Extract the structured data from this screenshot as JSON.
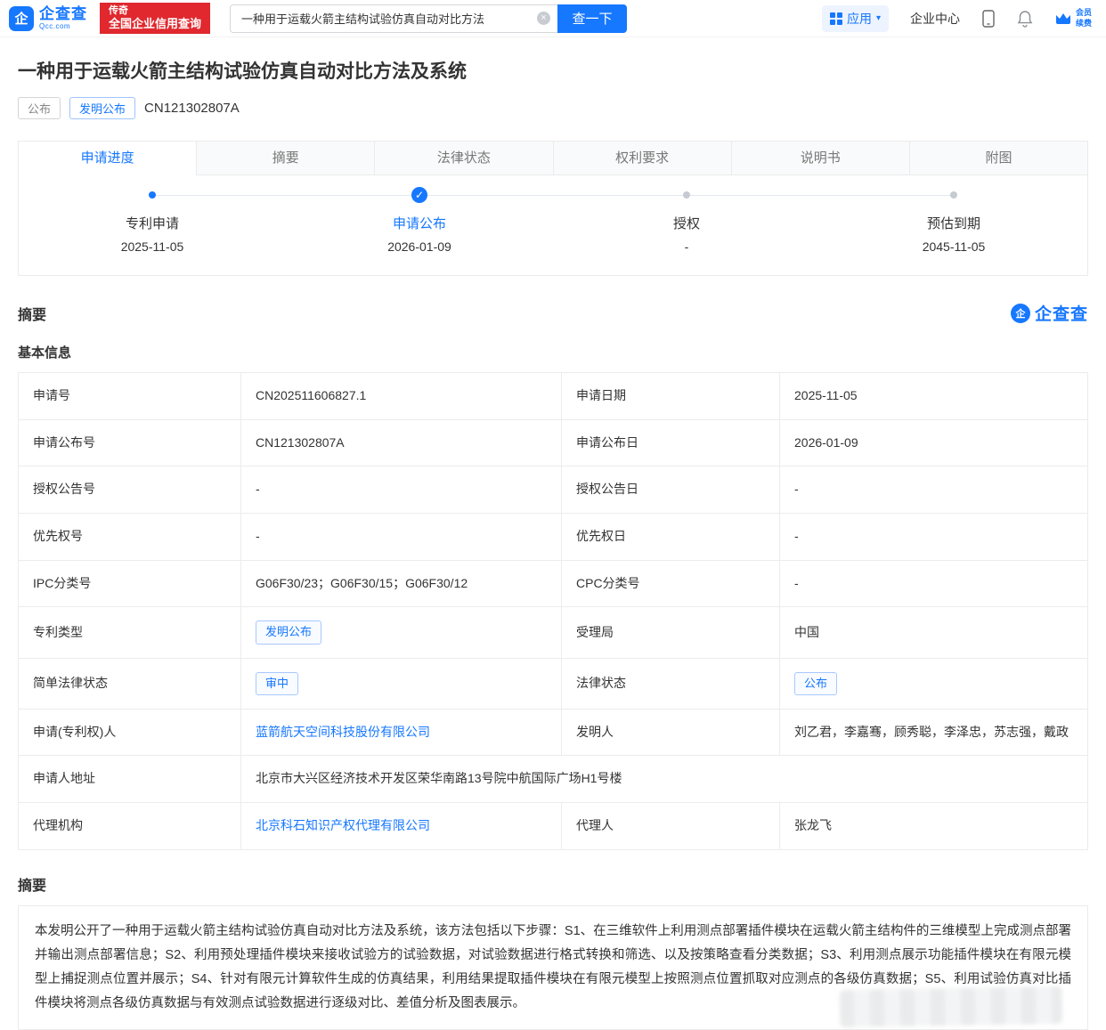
{
  "colors": {
    "brand": "#1677ff",
    "link": "#1677ff",
    "promo_red": "#e0282e"
  },
  "icons": {
    "check": "✓",
    "caret_down": "▾",
    "clear": "×"
  },
  "header": {
    "logo_text": "企查查",
    "logo_sub": "Qcc.com",
    "logo_glyph": "企",
    "promo_line1": "传奇",
    "promo_line2": "全国企业信用查询",
    "search_value": "一种用于运载火箭主结构试验仿真自动对比方法",
    "search_button": "查一下",
    "nav": {
      "app": "应用",
      "enterprise": "企业中心",
      "member_line1": "会员",
      "member_line2": "续费"
    }
  },
  "patent": {
    "title": "一种用于运载火箭主结构试验仿真自动对比方法及系统",
    "tag_publish": "公布",
    "tag_type": "发明公布",
    "publication_no": "CN121302807A"
  },
  "tabs": [
    {
      "label": "申请进度",
      "active": true
    },
    {
      "label": "摘要",
      "active": false
    },
    {
      "label": "法律状态",
      "active": false
    },
    {
      "label": "权利要求",
      "active": false
    },
    {
      "label": "说明书",
      "active": false
    },
    {
      "label": "附图",
      "active": false
    }
  ],
  "timeline": [
    {
      "label": "专利申请",
      "date": "2025-11-05",
      "state": "done"
    },
    {
      "label": "申请公布",
      "date": "2026-01-09",
      "state": "current"
    },
    {
      "label": "授权",
      "date": "-",
      "state": "pending"
    },
    {
      "label": "预估到期",
      "date": "2045-11-05",
      "state": "pending"
    }
  ],
  "summary": {
    "section_title": "摘要",
    "brand_logo_text": "企查查",
    "brand_logo_glyph": "企",
    "basic_info_title": "基本信息"
  },
  "info_table": {
    "rows": [
      {
        "c0": "申请号",
        "c1": "CN202511606827.1",
        "c2": "申请日期",
        "c3": "2025-11-05"
      },
      {
        "c0": "申请公布号",
        "c1": "CN121302807A",
        "c2": "申请公布日",
        "c3": "2026-01-09"
      },
      {
        "c0": "授权公告号",
        "c1": "-",
        "c2": "授权公告日",
        "c3": "-"
      },
      {
        "c0": "优先权号",
        "c1": "-",
        "c2": "优先权日",
        "c3": "-"
      },
      {
        "c0": "IPC分类号",
        "c1": "G06F30/23；G06F30/15；G06F30/12",
        "c2": "CPC分类号",
        "c3": "-"
      },
      {
        "c0": "专利类型",
        "c1": "发明公布",
        "c2": "受理局",
        "c3": "中国"
      },
      {
        "c0": "简单法律状态",
        "c1": "审中",
        "c2": "法律状态",
        "c3": "公布"
      },
      {
        "c0": "申请(专利权)人",
        "c1": "蓝箭航天空间科技股份有限公司",
        "c2": "发明人",
        "c3": "刘乙君，李嘉骞，顾秀聪，李泽忠，苏志强，戴政"
      },
      {
        "c0": "申请人地址",
        "c1": "北京市大兴区经济技术开发区荣华南路13号院中航国际广场H1号楼"
      },
      {
        "c0": "代理机构",
        "c1": "北京科石知识产权代理有限公司",
        "c2": "代理人",
        "c3": "张龙飞"
      }
    ]
  },
  "abstract": {
    "section_title": "摘要",
    "text": "本发明公开了一种用于运载火箭主结构试验仿真自动对比方法及系统，该方法包括以下步骤：S1、在三维软件上利用测点部署插件模块在运载火箭主结构件的三维模型上完成测点部署并输出测点部署信息；S2、利用预处理插件模块来接收试验方的试验数据，对试验数据进行格式转换和筛选、以及按策略查看分类数据；S3、利用测点展示功能插件模块在有限元模型上捕捉测点位置并展示；S4、针对有限元计算软件生成的仿真结果，利用结果提取插件模块在有限元模型上按照测点位置抓取对应测点的各级仿真数据；S5、利用试验仿真对比插件模块将测点各级仿真数据与有效测点试验数据进行逐级对比、差值分析及图表展示。"
  }
}
